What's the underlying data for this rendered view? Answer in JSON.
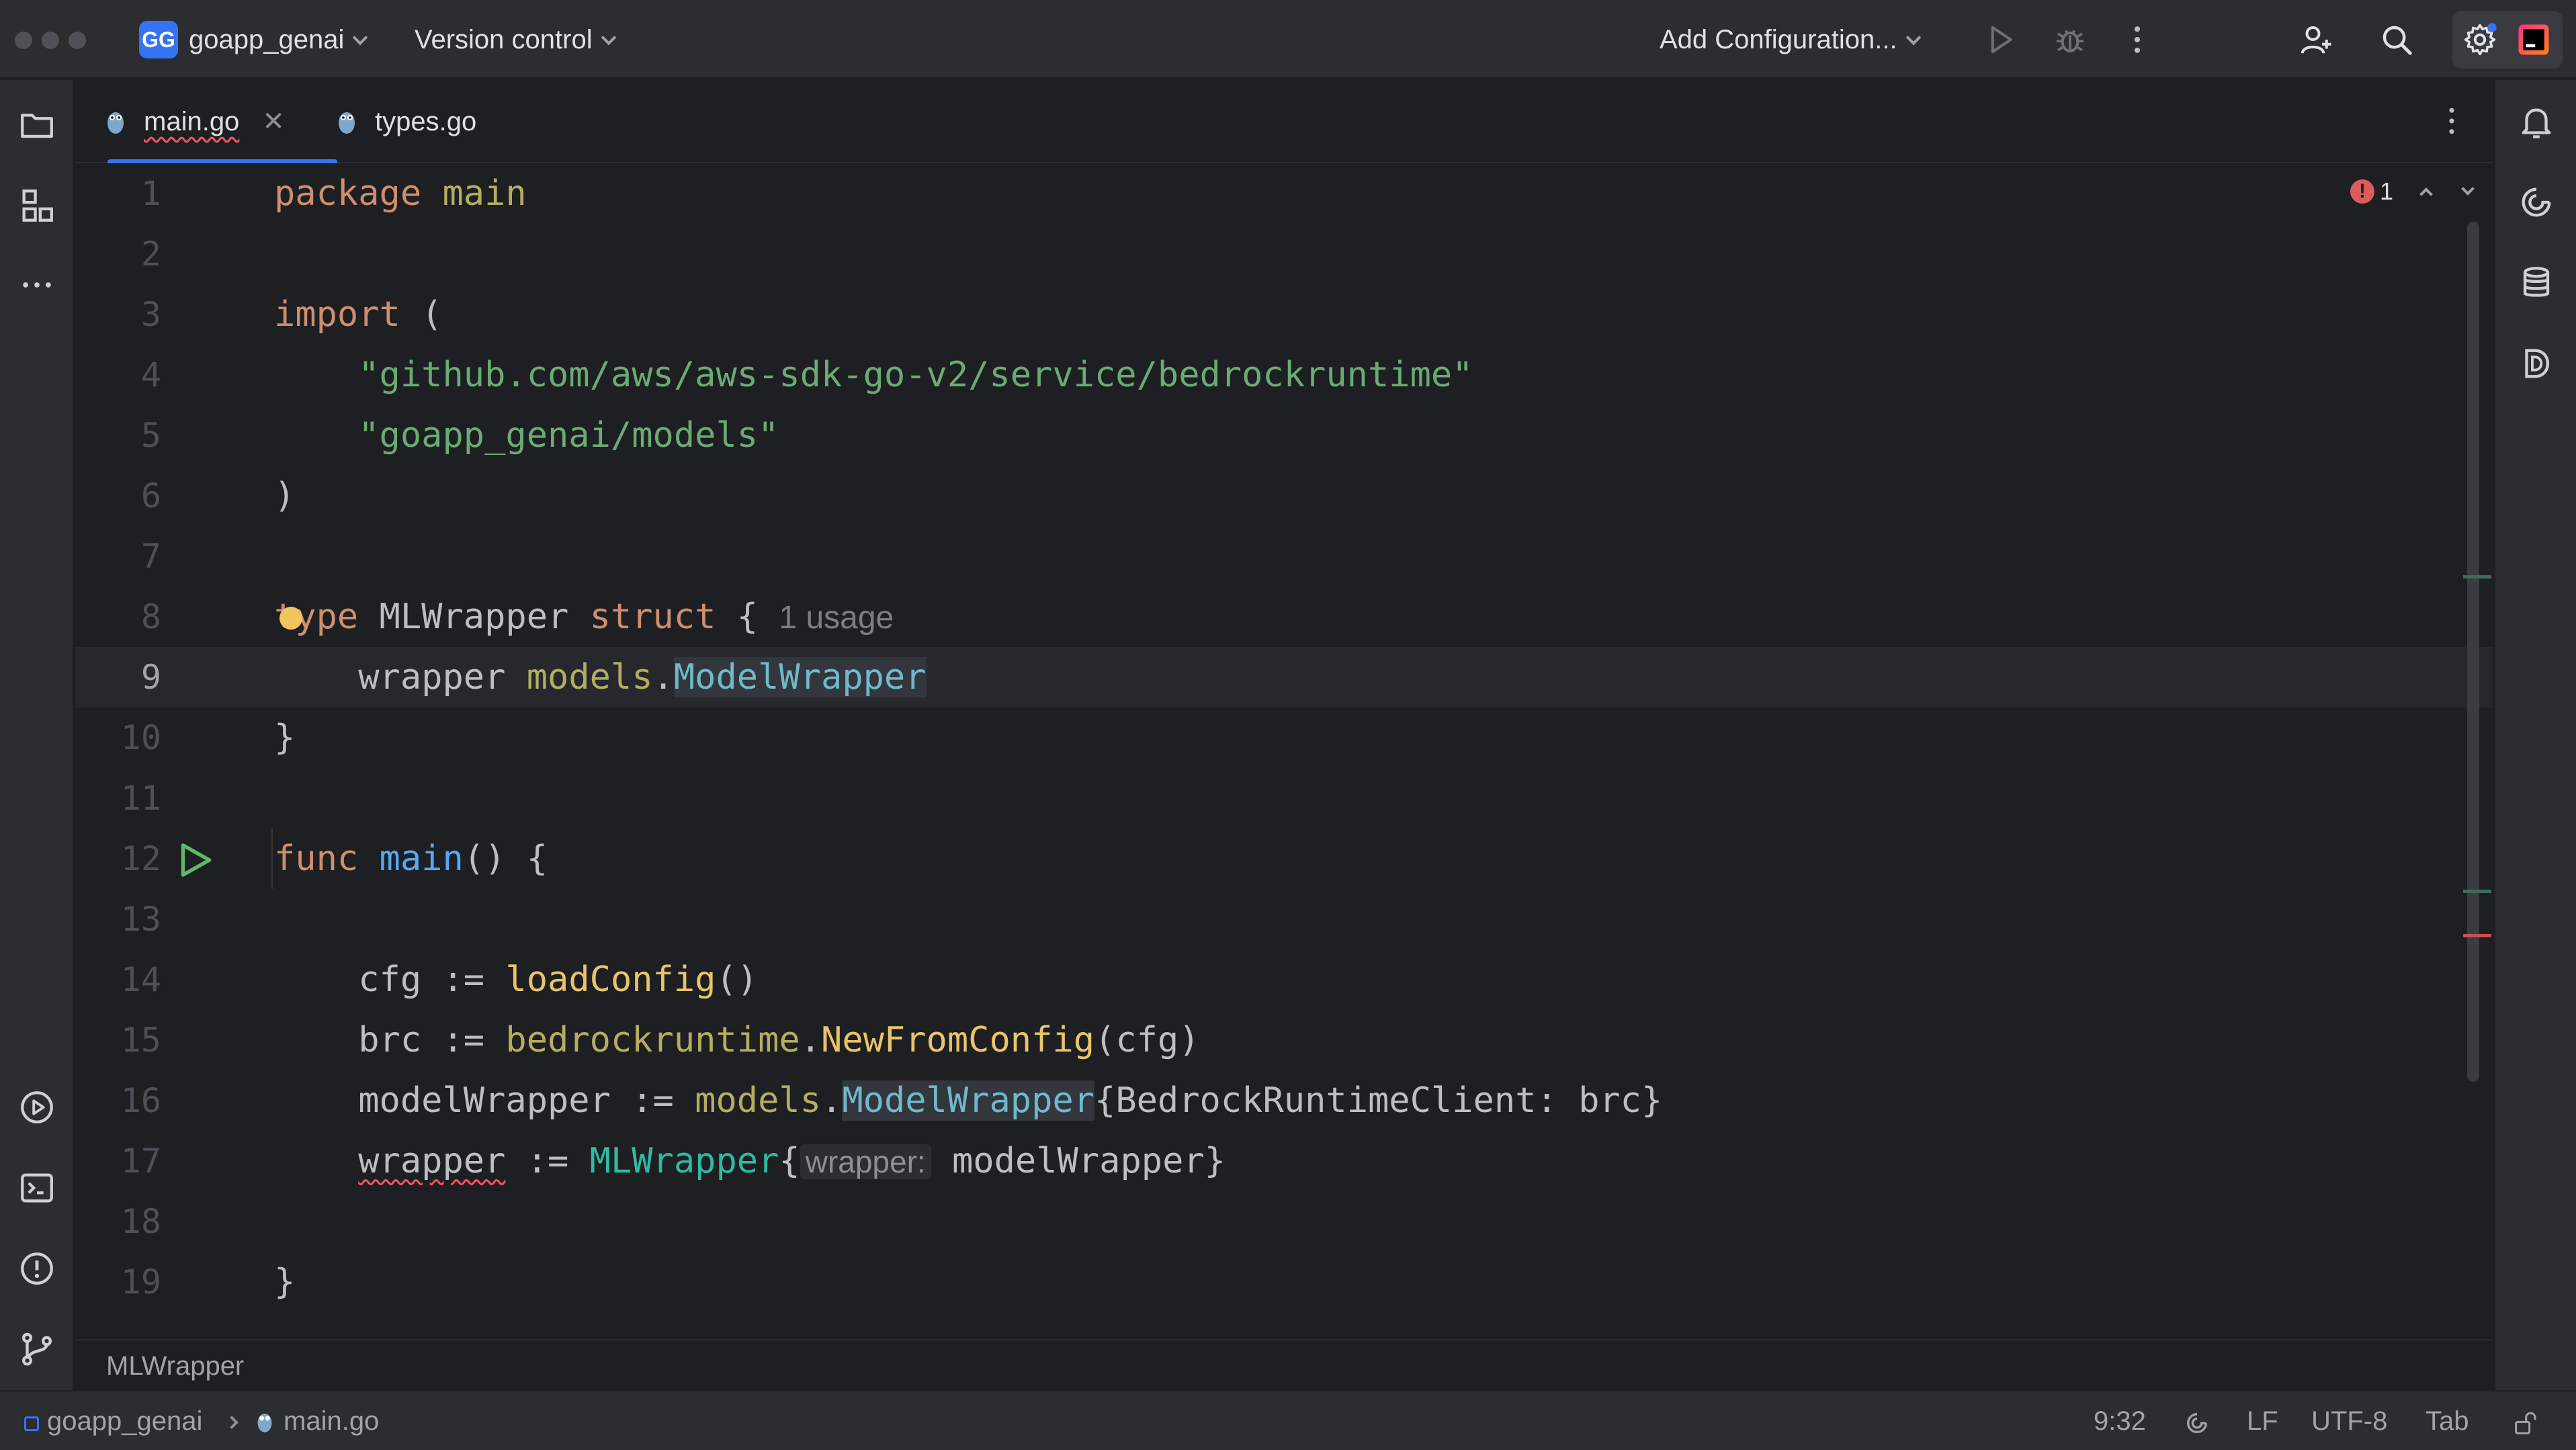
{
  "titlebar": {
    "project_badge": "GG",
    "project_name": "goapp_genai",
    "vcs_label": "Version control",
    "run_config": "Add Configuration..."
  },
  "icons": {
    "project": "folder-icon",
    "structure": "structure-icon",
    "more": "more-icon",
    "run_tool": "run-tool-icon",
    "terminal": "terminal-icon",
    "problems": "problems-icon",
    "git": "git-branch-icon",
    "notifications": "bell-icon",
    "ai": "ai-assistant-icon",
    "database": "database-icon",
    "ide_logo": "goland-logo-icon"
  },
  "tabs": [
    {
      "label": "main.go",
      "active": true,
      "has_error": true
    },
    {
      "label": "types.go",
      "active": false,
      "has_error": false
    }
  ],
  "editor": {
    "line_numbers": [
      "1",
      "2",
      "3",
      "4",
      "5",
      "6",
      "7",
      "8",
      "9",
      "10",
      "11",
      "12",
      "13",
      "14",
      "15",
      "16",
      "17",
      "18",
      "19"
    ],
    "usage_hint": "1 usage",
    "inlay_param": "wrapper:",
    "error_count": "1",
    "tokens": {
      "package": "package",
      "main": "main",
      "import": "import",
      "lparen": "(",
      "rparen": ")",
      "import1": "\"github.com/aws/aws-sdk-go-v2/service/bedrockruntime\"",
      "import2": "\"goapp_genai/models\"",
      "type": "type",
      "mlwrapper": "MLWrapper",
      "struct": "struct",
      "lbrace": "{",
      "rbrace": "}",
      "field_wrapper": "wrapper",
      "models": "models",
      "dot": ".",
      "modelwrapper": "ModelWrapper",
      "func": "func",
      "parens_open": "() {",
      "cfg": "cfg",
      "assign": ":=",
      "loadconfig": "loadConfig",
      "empty_call": "()",
      "brc": "brc",
      "bedrockruntime": "bedrockruntime",
      "newfromconfig": "NewFromConfig",
      "cfg_arg": "(cfg)",
      "modelwrapper_var": "modelWrapper",
      "brc_field": "{BedrockRuntimeClient: brc}",
      "wrapper_var": "wrapper",
      "mlwrapper_lit": "MLWrapper",
      "model_wrapper_arg": "modelWrapper}"
    }
  },
  "breadcrumb": {
    "symbol": "MLWrapper"
  },
  "statusbar": {
    "project": "goapp_genai",
    "file": "main.go",
    "position": "9:32",
    "line_ending": "LF",
    "encoding": "UTF-8",
    "indent": "Tab"
  }
}
